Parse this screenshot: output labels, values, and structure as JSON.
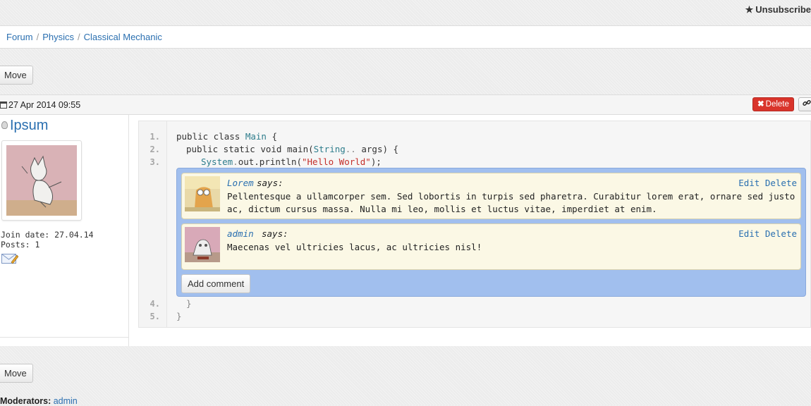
{
  "topbar": {
    "unsubscribe_label": "Unsubscribe",
    "star_icon": "★"
  },
  "breadcrumb": {
    "items": [
      "Forum",
      "Physics",
      "Classical Mechanic"
    ],
    "separator": "/"
  },
  "actions": {
    "move_label": "Move"
  },
  "post": {
    "date": "27 Apr 2014 09:55",
    "delete_label": "Delete",
    "delete_icon": "✖",
    "link_icon": "🔗",
    "author": {
      "name": "Ipsum",
      "join_date": "Join date: 27.04.14",
      "posts": "Posts: 1"
    },
    "code": {
      "line_numbers": [
        "1.",
        "2.",
        "3.",
        "4.",
        "5."
      ],
      "l1": {
        "kw": "public class ",
        "type": "Main",
        "rest": " {"
      },
      "l2": {
        "kw": "public static void main(",
        "type": "String",
        "dots": "..",
        "rest": " args) {"
      },
      "l3": {
        "type": "System",
        "dot": ".",
        "call": "out.println(",
        "str": "\"Hello World\"",
        "rest": ");"
      },
      "l4": "}",
      "l5": "}"
    },
    "comments": [
      {
        "author": "Lorem",
        "says": "says:",
        "text": "Pellentesque a ullamcorper sem. Sed lobortis in turpis sed pharetra. Curabitur lorem erat, ornare sed justo ac, dictum cursus massa. Nulla mi leo, mollis et luctus vitae, imperdiet at enim.",
        "edit_label": "Edit",
        "delete_label": "Delete"
      },
      {
        "author": "admin",
        "says": "says:",
        "text": "Maecenas vel ultricies lacus, ac ultricies nisl!",
        "edit_label": "Edit",
        "delete_label": "Delete"
      }
    ],
    "add_comment_label": "Add comment"
  },
  "footer": {
    "moderators_label": "Moderators:",
    "moderators": "admin"
  },
  "colors": {
    "link": "#2a6fb0",
    "danger": "#d9342b",
    "comment_bg": "#fbf8e5",
    "comment_box": "#a1bfee"
  }
}
